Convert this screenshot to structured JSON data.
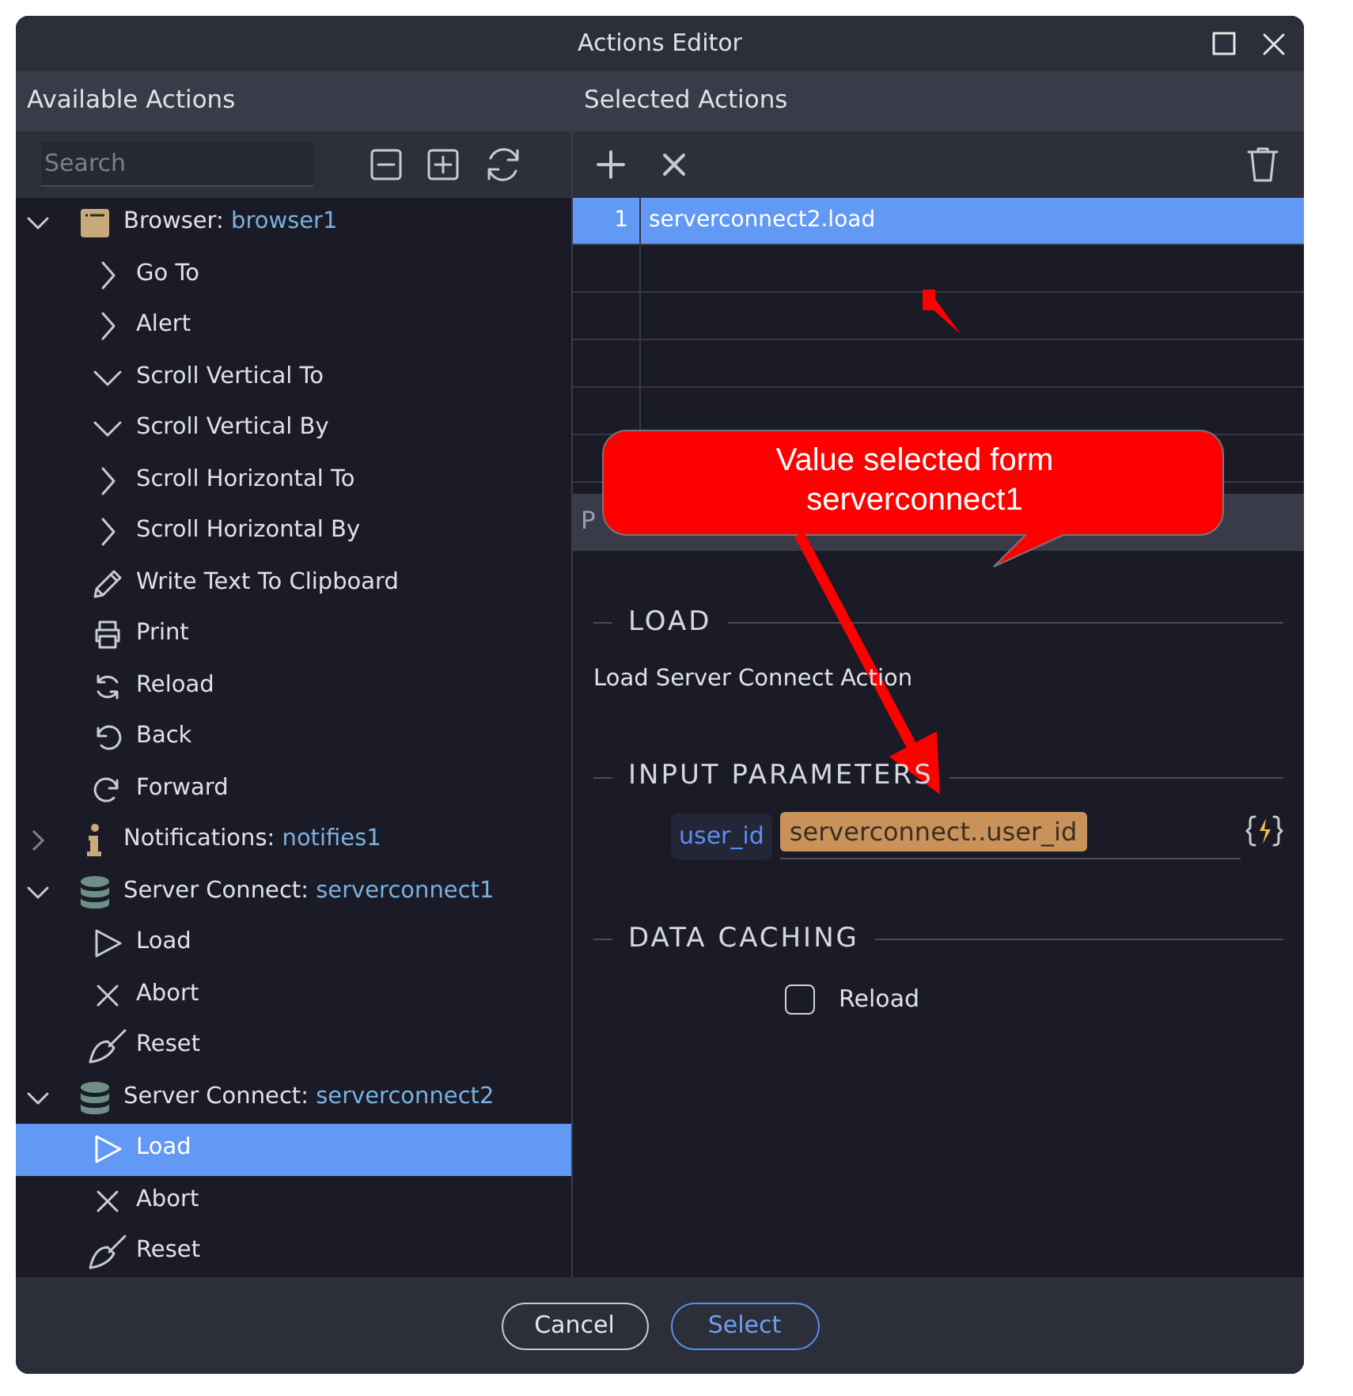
{
  "window": {
    "title": "Actions Editor"
  },
  "available_actions": {
    "title": "Available Actions",
    "search": {
      "placeholder": "Search"
    },
    "tree": [
      {
        "kind": "browser",
        "label": "Browser:",
        "name": "browser1",
        "expanded": true,
        "children": [
          {
            "kind": "goto",
            "label": "Go To",
            "selected": false
          },
          {
            "kind": "alert",
            "label": "Alert",
            "selected": false
          },
          {
            "kind": "scroll-v",
            "label": "Scroll Vertical To",
            "selected": false
          },
          {
            "kind": "scroll-v",
            "label": "Scroll Vertical By",
            "selected": false
          },
          {
            "kind": "scroll-h",
            "label": "Scroll Horizontal To",
            "selected": false
          },
          {
            "kind": "scroll-h",
            "label": "Scroll Horizontal By",
            "selected": false
          },
          {
            "kind": "clipboard",
            "label": "Write Text To Clipboard",
            "selected": false
          },
          {
            "kind": "print",
            "label": "Print",
            "selected": false
          },
          {
            "kind": "reload",
            "label": "Reload",
            "selected": false
          },
          {
            "kind": "back",
            "label": "Back",
            "selected": false
          },
          {
            "kind": "forward",
            "label": "Forward",
            "selected": false
          }
        ]
      },
      {
        "kind": "notifications",
        "label": "Notifications:",
        "name": "notifies1",
        "expanded": false
      },
      {
        "kind": "server-connect",
        "label": "Server Connect:",
        "name": "serverconnect1",
        "expanded": true,
        "children": [
          {
            "kind": "load",
            "label": "Load",
            "selected": false
          },
          {
            "kind": "abort",
            "label": "Abort",
            "selected": false
          },
          {
            "kind": "reset",
            "label": "Reset",
            "selected": false
          }
        ]
      },
      {
        "kind": "server-connect",
        "label": "Server Connect:",
        "name": "serverconnect2",
        "expanded": true,
        "children": [
          {
            "kind": "load",
            "label": "Load",
            "selected": true
          },
          {
            "kind": "abort",
            "label": "Abort",
            "selected": false
          },
          {
            "kind": "reset",
            "label": "Reset",
            "selected": false
          }
        ]
      }
    ]
  },
  "selected_actions": {
    "title": "Selected Actions",
    "rows": [
      {
        "number": "1",
        "action": "serverconnect2.load",
        "selected": true
      }
    ]
  },
  "properties": {
    "title": "P",
    "sections": [
      {
        "kind": "description",
        "heading": "LOAD",
        "text": "Load Server Connect Action"
      },
      {
        "kind": "parameters",
        "heading": "INPUT PARAMETERS",
        "params": [
          {
            "name": "user_id",
            "value": "serverconnect..user_id"
          }
        ]
      },
      {
        "kind": "options",
        "heading": "DATA CACHING",
        "options": [
          {
            "label": "Reload",
            "checked": false
          }
        ]
      }
    ]
  },
  "footer": {
    "buttons": [
      {
        "kind": "secondary",
        "label": "Cancel"
      },
      {
        "kind": "primary",
        "label": "Select"
      }
    ]
  },
  "annotation": {
    "text": "Value selected form serverconnect1"
  }
}
